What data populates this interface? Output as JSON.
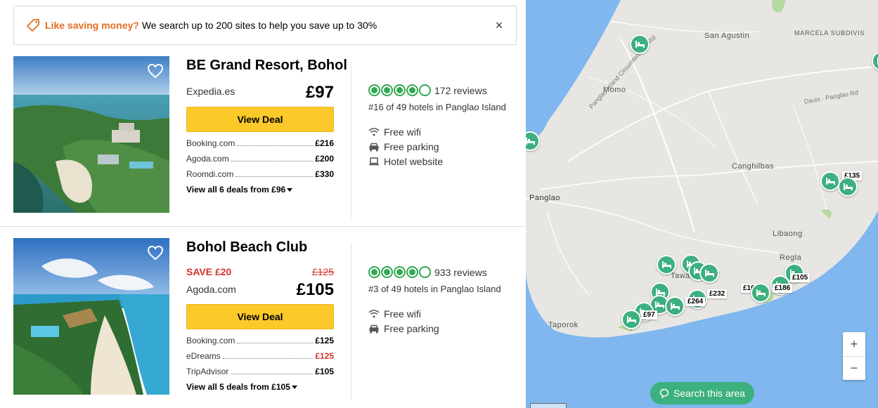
{
  "banner": {
    "highlight": "Like saving money?",
    "text": "We search up to 200 sites to help you save up to 30%",
    "close_symbol": "×"
  },
  "hotels": [
    {
      "name": "BE Grand Resort, Bohol",
      "provider": "Expedia.es",
      "price": "£97",
      "deal_label": "View Deal",
      "other_offers": [
        {
          "name": "Booking.com",
          "price": "£216"
        },
        {
          "name": "Agoda.com",
          "price": "£200"
        },
        {
          "name": "Roomdi.com",
          "price": "£330"
        }
      ],
      "view_all": "View all 6 deals from £96",
      "rating_bubbles": 4,
      "reviews": "172 reviews",
      "rank": "#16 of 49 hotels in Panglao Island",
      "amenities": [
        "Free wifi",
        "Free parking",
        "Hotel website"
      ]
    },
    {
      "name": "Bohol Beach Club",
      "save": "SAVE £20",
      "old_price": "£125",
      "provider": "Agoda.com",
      "price": "£105",
      "deal_label": "View Deal",
      "other_offers": [
        {
          "name": "Booking.com",
          "price": "£125"
        },
        {
          "name": "eDreams",
          "price": "£125"
        },
        {
          "name": "TripAdvisor",
          "price": "£105"
        }
      ],
      "view_all": "View all 5 deals from £105",
      "rating_bubbles": 4,
      "reviews": "933 reviews",
      "rank": "#3 of 49 hotels in Panglao Island",
      "amenities": [
        "Free wifi",
        "Free parking"
      ]
    }
  ],
  "map": {
    "places": [
      "San Agustin",
      "MARCELA SUBDIVIS",
      "Momo",
      "Canghilbas",
      "Panglao",
      "Libaong",
      "Regla",
      "Taporok",
      "Tawala"
    ],
    "roads": [
      "Panglao Island Circumferential Rd",
      "Dauis - Panglao Rd"
    ],
    "price_labels": [
      "£135",
      "£105",
      "£186",
      "£16",
      "£232",
      "£264",
      "£97"
    ],
    "zoom_in": "+",
    "zoom_out": "−",
    "search_area_label": "Search this area"
  },
  "colors": {
    "accent_orange": "#e26e1f",
    "deal_button": "#fcc92a",
    "rating_green": "#34a853",
    "pin_green": "#3db07f",
    "save_red": "#d6322c",
    "water": "#7fb7ee",
    "land": "#e8e6e3"
  }
}
